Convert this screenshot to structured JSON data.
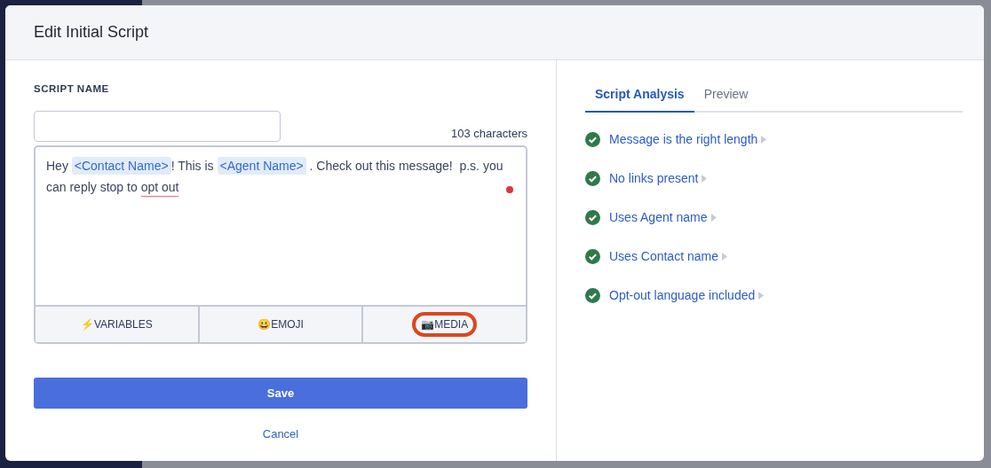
{
  "modal": {
    "title": "Edit Initial Script"
  },
  "script_name": {
    "label": "SCRIPT NAME"
  },
  "counter": "103 characters",
  "message": {
    "segments": [
      {
        "kind": "text",
        "text": "Hey "
      },
      {
        "kind": "variable",
        "text": "<Contact Name>"
      },
      {
        "kind": "text",
        "text": "! This is "
      },
      {
        "kind": "variable",
        "text": "<Agent Name>"
      },
      {
        "kind": "text",
        "text": " . Check out this message!  p.s. you can reply stop to "
      },
      {
        "kind": "misspelled",
        "text": "opt out"
      }
    ],
    "unsaved_dot": true
  },
  "toolbar": [
    {
      "icon": "⚡",
      "label": "VARIABLES",
      "highlighted": false
    },
    {
      "icon": "😀",
      "label": "EMOJI",
      "highlighted": false
    },
    {
      "icon": "📷",
      "label": "MEDIA",
      "highlighted": true
    }
  ],
  "buttons": {
    "save": "Save",
    "cancel": "Cancel"
  },
  "tabs": [
    {
      "label": "Script Analysis",
      "selected": true
    },
    {
      "label": "Preview",
      "selected": false
    }
  ],
  "checks": [
    {
      "label": "Message is the right length",
      "passed": true
    },
    {
      "label": "No links present",
      "passed": true
    },
    {
      "label": "Uses Agent name",
      "passed": true
    },
    {
      "label": "Uses Contact name",
      "passed": true
    },
    {
      "label": "Opt-out language included",
      "passed": true
    }
  ]
}
